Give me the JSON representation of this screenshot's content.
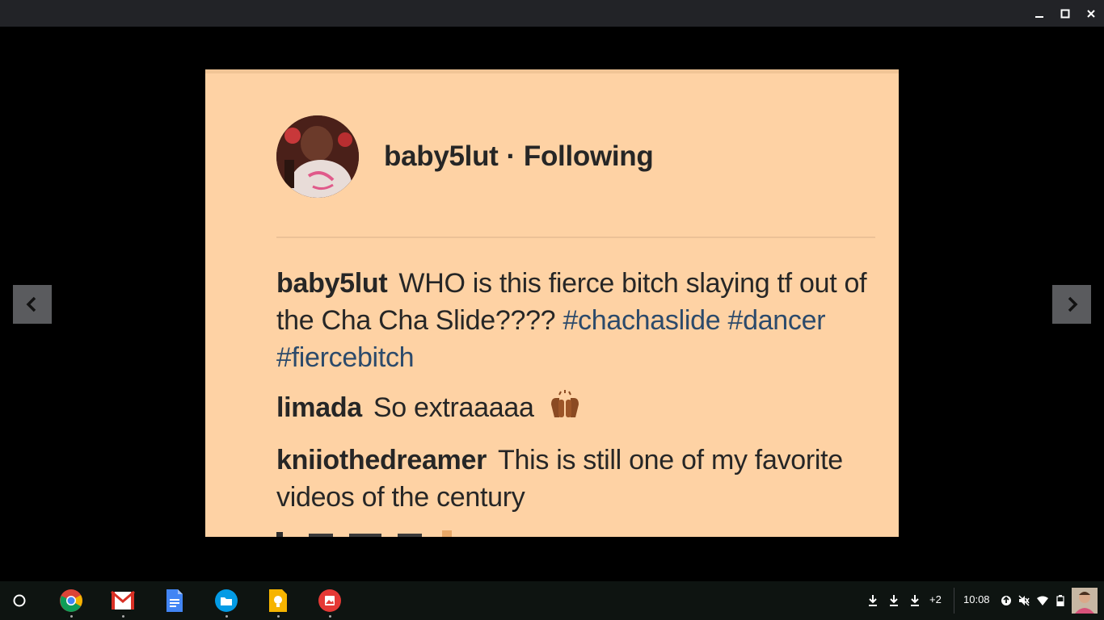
{
  "window": {
    "controls": [
      "minimize-icon",
      "maximize-icon",
      "close-icon"
    ]
  },
  "post": {
    "username": "baby5lut",
    "separator": "·",
    "follow_status": "Following",
    "comments": [
      {
        "user": "baby5lut",
        "text": "WHO is this fierce bitch slaying tf out of the Cha Cha Slide????",
        "tags": [
          "#chachaslide",
          "#dancer",
          "#fiercebitch"
        ]
      },
      {
        "user": "limada",
        "text": "So extraaaaa",
        "emoji": "raising-hands-emoji"
      },
      {
        "user": "kniiothedreamer",
        "text": "This is still one of my favorite videos of the century"
      }
    ]
  },
  "shelf": {
    "apps": [
      "launcher-icon",
      "chrome-icon",
      "gmail-icon",
      "docs-icon",
      "files-icon",
      "keep-icon",
      "gallery-icon"
    ],
    "notifications_more": "+2",
    "clock": "10:08"
  },
  "colors": {
    "photo_bg": "#fed2a4",
    "hashtag": "#2c4a6b",
    "shelf_bg": "#0e1411"
  }
}
